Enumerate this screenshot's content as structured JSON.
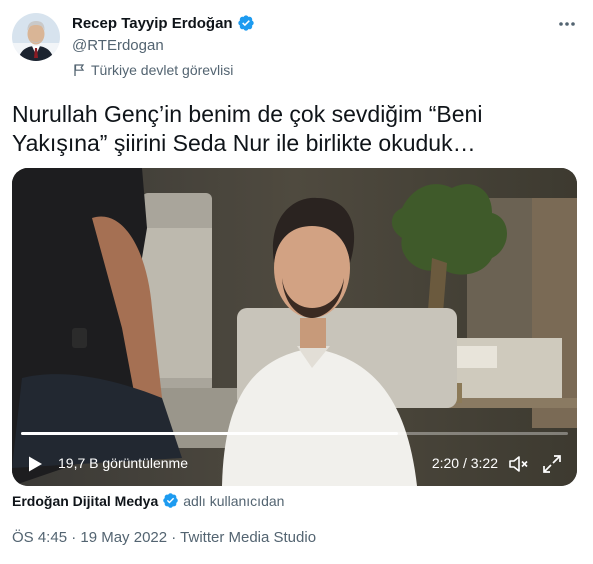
{
  "author": {
    "name": "Recep Tayyip Erdoğan",
    "handle": "@RTErdogan",
    "label": "Türkiye devlet görevlisi",
    "verified_icon": "verified-badge-icon",
    "label_icon": "flag-icon"
  },
  "tweet": {
    "text": "Nurullah Genç’in benim de çok sevdiğim “Beni Yakışına” şiirini Seda Nur ile birlikte okuduk…"
  },
  "video": {
    "views": "19,7 B görüntülenme",
    "time": "2:20 / 3:22",
    "progress": 0.69
  },
  "attribution": {
    "source": "Erdoğan Dijital Medya",
    "suffix": "adlı kullanıcıdan"
  },
  "meta": {
    "line": "ÖS 4:45 · 19 May 2022 · Twitter Media Studio"
  },
  "colors": {
    "verified": "#1d9bf0",
    "secondary_text": "#536471",
    "primary_text": "#0f1419"
  }
}
